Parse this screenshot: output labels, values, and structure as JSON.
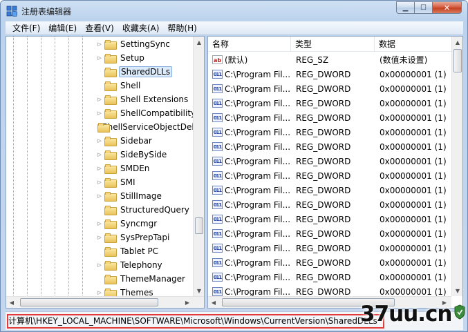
{
  "window": {
    "title": "注册表编辑器",
    "controls": {
      "minimize": "▁",
      "maximize": "☐",
      "close": "✕"
    }
  },
  "menu": [
    "文件(F)",
    "编辑(E)",
    "查看(V)",
    "收藏夹(A)",
    "帮助(H)"
  ],
  "tree": {
    "nodes": [
      {
        "label": "SettingSync",
        "expandable": true
      },
      {
        "label": "Setup",
        "expandable": true
      },
      {
        "label": "SharedDLLs",
        "expandable": false,
        "selected": true
      },
      {
        "label": "Shell",
        "expandable": false
      },
      {
        "label": "Shell Extensions",
        "expandable": true
      },
      {
        "label": "ShellCompatibility",
        "expandable": true
      },
      {
        "label": "ShellServiceObjectDelayLoad",
        "expandable": false
      },
      {
        "label": "Sidebar",
        "expandable": true
      },
      {
        "label": "SideBySide",
        "expandable": true
      },
      {
        "label": "SMDEn",
        "expandable": true
      },
      {
        "label": "SMI",
        "expandable": true
      },
      {
        "label": "StillImage",
        "expandable": true
      },
      {
        "label": "StructuredQuery",
        "expandable": false
      },
      {
        "label": "Syncmgr",
        "expandable": true
      },
      {
        "label": "SysPrepTapi",
        "expandable": true
      },
      {
        "label": "Tablet PC",
        "expandable": false
      },
      {
        "label": "Telephony",
        "expandable": true
      },
      {
        "label": "ThemeManager",
        "expandable": false
      },
      {
        "label": "Themes",
        "expandable": true
      }
    ]
  },
  "list": {
    "columns": [
      "名称",
      "类型",
      "数据"
    ],
    "rows": [
      {
        "icon": "ab",
        "name": "(默认)",
        "type": "REG_SZ",
        "data": "(数值未设置)"
      },
      {
        "icon": "dw",
        "name": "C:\\Program Fil...",
        "type": "REG_DWORD",
        "data": "0x00000001 (1)"
      },
      {
        "icon": "dw",
        "name": "C:\\Program Fil...",
        "type": "REG_DWORD",
        "data": "0x00000001 (1)"
      },
      {
        "icon": "dw",
        "name": "C:\\Program Fil...",
        "type": "REG_DWORD",
        "data": "0x00000001 (1)"
      },
      {
        "icon": "dw",
        "name": "C:\\Program Fil...",
        "type": "REG_DWORD",
        "data": "0x00000001 (1)"
      },
      {
        "icon": "dw",
        "name": "C:\\Program Fil...",
        "type": "REG_DWORD",
        "data": "0x00000001 (1)"
      },
      {
        "icon": "dw",
        "name": "C:\\Program Fil...",
        "type": "REG_DWORD",
        "data": "0x00000001 (1)"
      },
      {
        "icon": "dw",
        "name": "C:\\Program Fil...",
        "type": "REG_DWORD",
        "data": "0x00000001 (1)"
      },
      {
        "icon": "dw",
        "name": "C:\\Program Fil...",
        "type": "REG_DWORD",
        "data": "0x00000001 (1)"
      },
      {
        "icon": "dw",
        "name": "C:\\Program Fil...",
        "type": "REG_DWORD",
        "data": "0x00000001 (1)"
      },
      {
        "icon": "dw",
        "name": "C:\\Program Fil...",
        "type": "REG_DWORD",
        "data": "0x00000001 (1)"
      },
      {
        "icon": "dw",
        "name": "C:\\Program Fil...",
        "type": "REG_DWORD",
        "data": "0x00000001 (1)"
      },
      {
        "icon": "dw",
        "name": "C:\\Program Fil...",
        "type": "REG_DWORD",
        "data": "0x00000001 (1)"
      },
      {
        "icon": "dw",
        "name": "C:\\Program Fil...",
        "type": "REG_DWORD",
        "data": "0x00000001 (1)"
      },
      {
        "icon": "dw",
        "name": "C:\\Program Fil...",
        "type": "REG_DWORD",
        "data": "0x00000001 (1)"
      },
      {
        "icon": "dw",
        "name": "C:\\Program Fil...",
        "type": "REG_DWORD",
        "data": "0x00000001 (1)"
      },
      {
        "icon": "dw",
        "name": "C:\\Program Fil...",
        "type": "REG_DWORD",
        "data": "0x00000001 (1)"
      },
      {
        "icon": "dw",
        "name": "C:\\Program Fil...",
        "type": "REG_DWORD",
        "data": "0x00000001 (1)"
      }
    ]
  },
  "status": {
    "path": "计算机\\HKEY_LOCAL_MACHINE\\SOFTWARE\\Microsoft\\Windows\\CurrentVersion\\SharedDLLs"
  },
  "watermark": "37uu.cn",
  "colors": {
    "highlight_border": "#e23a3a",
    "selection_bg": "#dcebfc"
  }
}
